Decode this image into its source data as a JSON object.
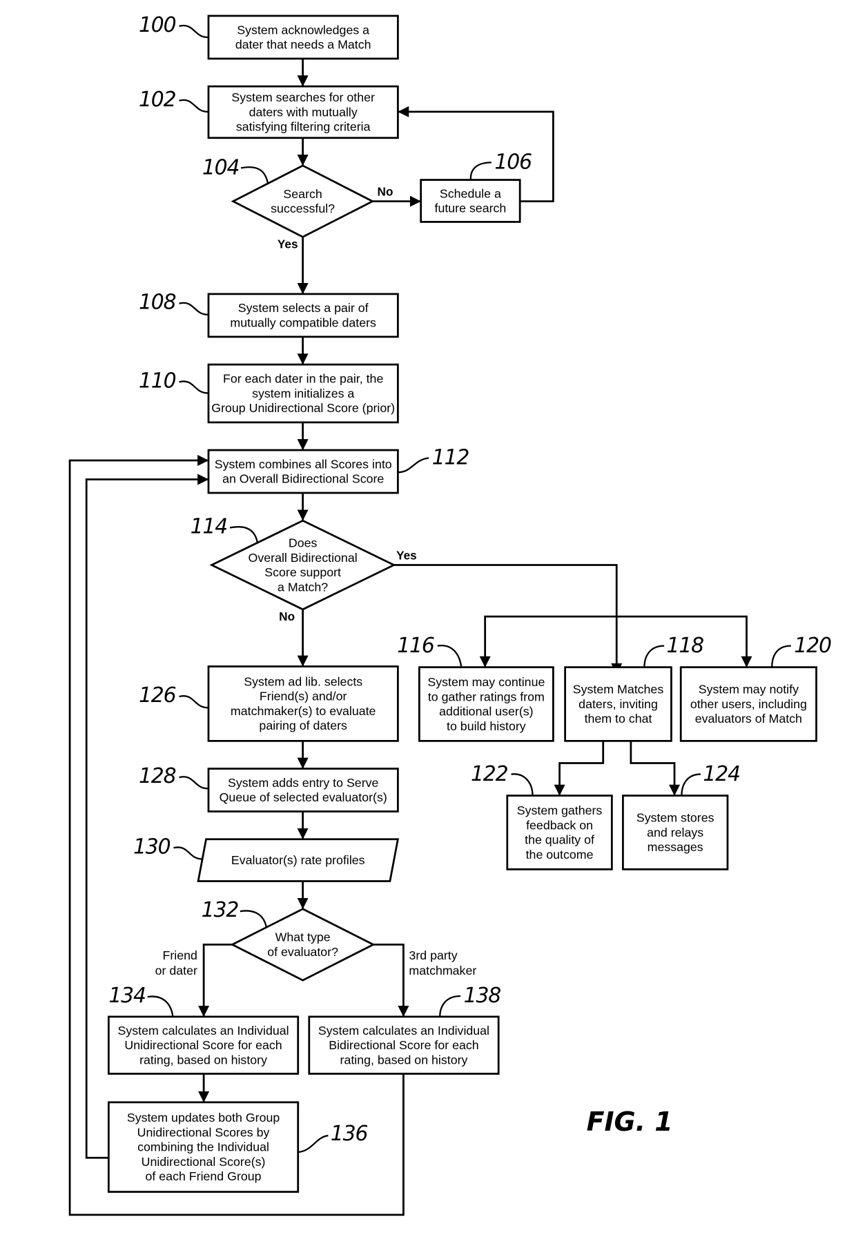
{
  "figure": {
    "title": "FIG. 1",
    "nodes": [
      {
        "id": "100",
        "shape": "process",
        "lines": [
          "System acknowledges a",
          "dater that needs a Match"
        ]
      },
      {
        "id": "102",
        "shape": "process",
        "lines": [
          "System searches for other",
          "daters with mutually",
          "satisfying filtering criteria"
        ]
      },
      {
        "id": "104",
        "shape": "decision",
        "lines": [
          "Search",
          "successful?"
        ]
      },
      {
        "id": "106",
        "shape": "process",
        "lines": [
          "Schedule a",
          "future search"
        ]
      },
      {
        "id": "108",
        "shape": "process",
        "lines": [
          "System selects a pair of",
          "mutually compatible daters"
        ]
      },
      {
        "id": "110",
        "shape": "process",
        "lines": [
          "For each dater in the pair, the",
          "system initializes a",
          "Group Unidirectional Score (prior)"
        ]
      },
      {
        "id": "112",
        "shape": "process",
        "lines": [
          "System combines all Scores into",
          "an Overall Bidirectional Score"
        ]
      },
      {
        "id": "114",
        "shape": "decision",
        "lines": [
          "Does",
          "Overall Bidirectional",
          "Score support",
          "a Match?"
        ]
      },
      {
        "id": "116",
        "shape": "process",
        "lines": [
          "System may continue",
          "to gather ratings from",
          "additional user(s)",
          "to build history"
        ]
      },
      {
        "id": "118",
        "shape": "process",
        "lines": [
          "System Matches",
          "daters, inviting",
          "them to chat"
        ]
      },
      {
        "id": "120",
        "shape": "process",
        "lines": [
          "System may notify",
          "other users, including",
          "evaluators of Match"
        ]
      },
      {
        "id": "122",
        "shape": "process",
        "lines": [
          "System gathers",
          "feedback on",
          "the quality of",
          "the outcome"
        ]
      },
      {
        "id": "124",
        "shape": "process",
        "lines": [
          "System stores",
          "and relays",
          "messages"
        ]
      },
      {
        "id": "126",
        "shape": "process",
        "lines": [
          "System ad lib. selects",
          "Friend(s) and/or",
          "matchmaker(s) to evaluate",
          "pairing of daters"
        ]
      },
      {
        "id": "128",
        "shape": "process",
        "lines": [
          "System adds entry to Serve",
          "Queue of selected evaluator(s)"
        ]
      },
      {
        "id": "130",
        "shape": "data",
        "lines": [
          "Evaluator(s) rate profiles"
        ]
      },
      {
        "id": "132",
        "shape": "decision",
        "lines": [
          "What type",
          "of evaluator?"
        ]
      },
      {
        "id": "134",
        "shape": "process",
        "lines": [
          "System calculates an Individual",
          "Unidirectional Score for each",
          "rating, based on history"
        ]
      },
      {
        "id": "136",
        "shape": "process",
        "lines": [
          "System updates both Group",
          "Unidirectional Scores by",
          "combining the Individual",
          "Unidirectional Score(s)",
          "of each Friend Group"
        ]
      },
      {
        "id": "138",
        "shape": "process",
        "lines": [
          "System calculates an Individual",
          "Bidirectional Score for each",
          "rating, based on history"
        ]
      }
    ],
    "edge_labels": {
      "search_no": "No",
      "search_yes": "Yes",
      "match_yes": "Yes",
      "match_no": "No",
      "eval_friend": [
        "Friend",
        "or dater"
      ],
      "eval_third": [
        "3rd party",
        "matchmaker"
      ]
    },
    "edges": [
      [
        "100",
        "102"
      ],
      [
        "102",
        "104"
      ],
      [
        "104",
        "106",
        "No"
      ],
      [
        "106",
        "102"
      ],
      [
        "104",
        "108",
        "Yes"
      ],
      [
        "108",
        "110"
      ],
      [
        "110",
        "112"
      ],
      [
        "112",
        "114"
      ],
      [
        "114",
        "118",
        "Yes"
      ],
      [
        "114",
        "116",
        "Yes"
      ],
      [
        "114",
        "120",
        "Yes"
      ],
      [
        "118",
        "122"
      ],
      [
        "118",
        "124"
      ],
      [
        "114",
        "126",
        "No"
      ],
      [
        "126",
        "128"
      ],
      [
        "128",
        "130"
      ],
      [
        "130",
        "132"
      ],
      [
        "132",
        "134",
        "Friend or dater"
      ],
      [
        "132",
        "138",
        "3rd party matchmaker"
      ],
      [
        "134",
        "136"
      ],
      [
        "136",
        "112"
      ],
      [
        "138",
        "112"
      ]
    ]
  }
}
